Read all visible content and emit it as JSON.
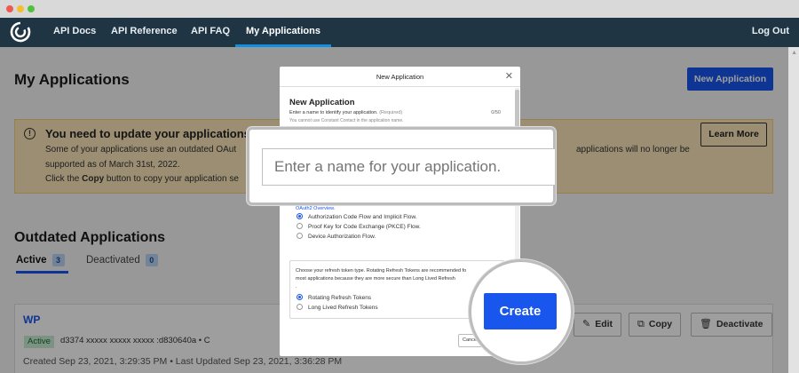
{
  "nav": {
    "links": [
      "API Docs",
      "API Reference",
      "API FAQ",
      "My Applications"
    ],
    "logout": "Log Out"
  },
  "page": {
    "title": "My Applications",
    "new_app_button": "New Application"
  },
  "warning": {
    "title": "You need to update your applications",
    "line1": "Some of your applications use an outdated OAut",
    "line1_right": "applications will no longer be",
    "line2": "supported as of March 31st, 2022.",
    "line3_pre": "Click the ",
    "line3_bold": "Copy",
    "line3_post": " button to copy your application se",
    "learn_more": "Learn More",
    "icon": "info-icon"
  },
  "outdated": {
    "title": "Outdated Applications",
    "tabs": [
      {
        "label": "Active",
        "count": "3"
      },
      {
        "label": "Deactivated",
        "count": "0"
      }
    ]
  },
  "card": {
    "name": "WP",
    "status": "Active",
    "key": "d3374 xxxxx     xxxxx     xxxxx  :d830640a • C",
    "created": "Created Sep 23, 2021, 3:29:35 PM • Last Updated Sep 23, 2021, 3:36:28 PM",
    "buttons": [
      "Edit",
      "Copy",
      "Deactivate"
    ]
  },
  "modal": {
    "title": "New Application",
    "heading": "New Application",
    "sub": "Enter a name to identify your application.",
    "required": "(Required)",
    "count": "0/50",
    "note": "You cannot use Constant Contact in the application name.",
    "oauth_link": "OAuth2 Overview.",
    "flows": [
      "Authorization Code Flow and Implicit Flow.",
      "Proof Key for Code Exchange (PKCE) Flow.",
      "Device Authorization Flow."
    ],
    "refresh_text": [
      "Choose your refresh token type. Rotating Refresh Tokens are recommended fo",
      "most applications because they are more secure than Long Lived Refresh",
      "."
    ],
    "tokens": [
      "Rotating Refresh Tokens",
      "Long Lived Refresh Tokens"
    ],
    "cancel": "Cancel"
  },
  "zoom": {
    "input_placeholder": "Enter a name for your application.",
    "create": "Create"
  },
  "colors": {
    "nav_bg": "#1f3544",
    "primary": "#1856ed",
    "warning_bg": "#fae6b8"
  }
}
